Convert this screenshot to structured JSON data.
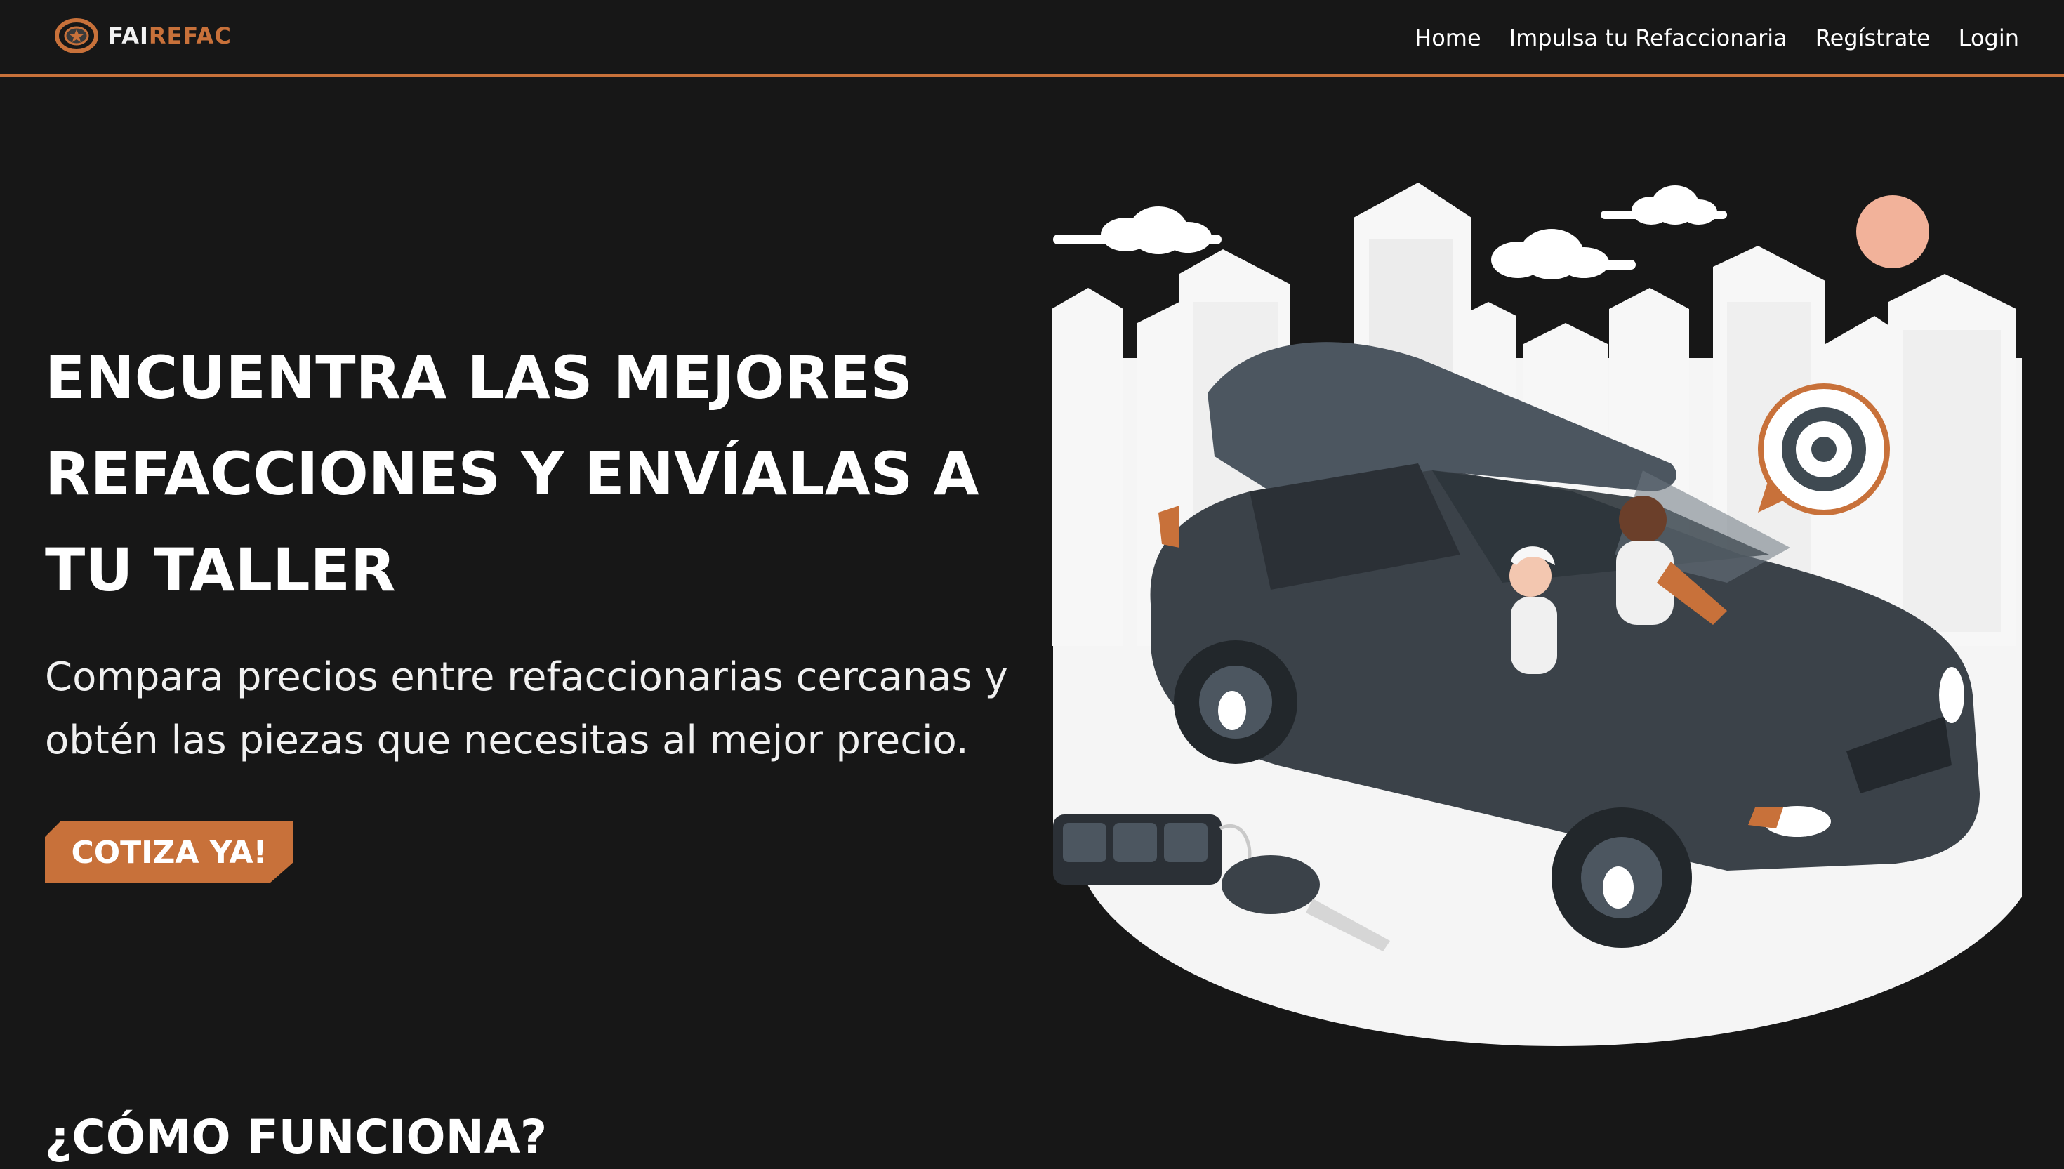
{
  "header": {
    "logo": {
      "part1": "FAI",
      "part2": "REFAC",
      "icon": "tire-logo-icon"
    },
    "nav": [
      {
        "label": "Home"
      },
      {
        "label": "Impulsa tu Refaccionaria"
      },
      {
        "label": "Regístrate"
      },
      {
        "label": "Login"
      }
    ]
  },
  "hero": {
    "title": "ENCUENTRA LAS MEJORES REFACCIONES Y ENVÍALAS A TU TALLER",
    "subtitle": "Compara precios entre refaccionarias cercanas y obtén las piezas que necesitas al mejor precio.",
    "cta_label": "COTIZA YA!",
    "illustration": "car-with-driver-city-illustration"
  },
  "section": {
    "title": "¿CÓMO FUNCIONA?"
  },
  "colors": {
    "accent": "#c8713a",
    "background": "#171717",
    "text": "#ffffff"
  }
}
